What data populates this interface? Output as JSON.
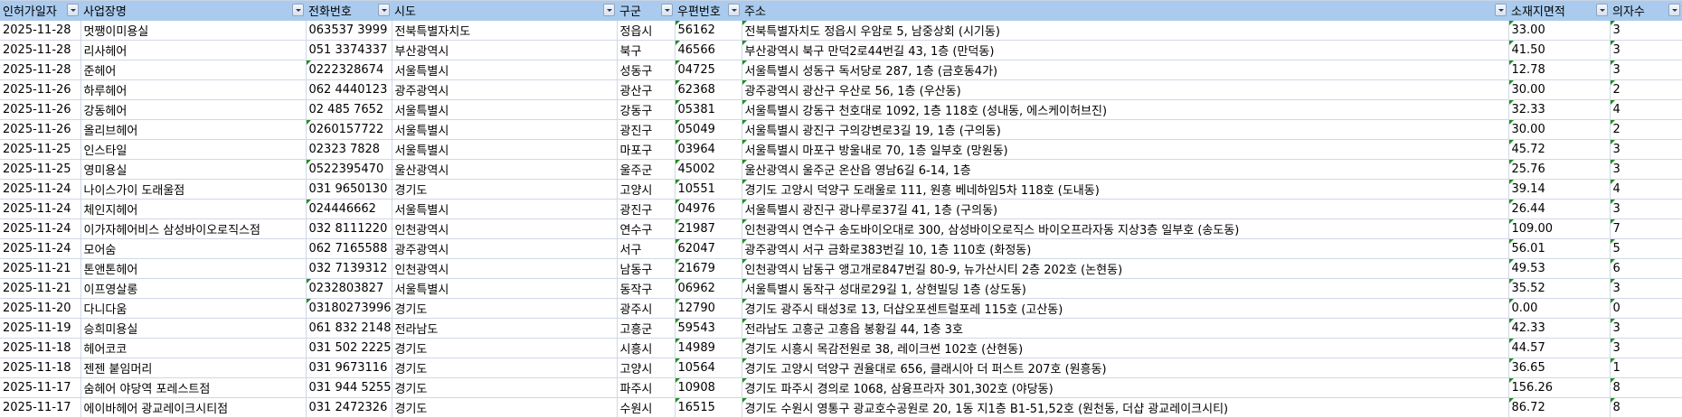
{
  "columns": [
    "인허가일자",
    "사업장명",
    "전화번호",
    "시도",
    "구군",
    "우편번호",
    "주소",
    "소재지면적",
    "의자수"
  ],
  "rows": [
    [
      "2025-11-28",
      "멋쨍이미용실",
      "063537 3999",
      "전북특별자치도",
      "정읍시",
      "56162",
      "전북특별자치도 정읍시 우암로 5, 남중상회 (시기동)",
      "33.00",
      "3"
    ],
    [
      "2025-11-28",
      "리사헤어",
      "051 3374337",
      "부산광역시",
      "북구",
      "46566",
      "부산광역시 북구 만덕2로44번길 43, 1층 (만덕동)",
      "41.50",
      "3"
    ],
    [
      "2025-11-28",
      "준헤어",
      "0222328674",
      "서울특별시",
      "성동구",
      "04725",
      "서울특별시 성동구 독서당로 287, 1층 (금호동4가)",
      "12.78",
      "3"
    ],
    [
      "2025-11-26",
      "하루헤어",
      "062 4440123",
      "광주광역시",
      "광산구",
      "62368",
      "광주광역시 광산구 우산로 56, 1층 (우산동)",
      "30.00",
      "2"
    ],
    [
      "2025-11-26",
      "강동헤어",
      "02  485 7652",
      "서울특별시",
      "강동구",
      "05381",
      "서울특별시 강동구 천호대로 1092, 1층 118호 (성내동, 에스케이허브진)",
      "32.33",
      "4"
    ],
    [
      "2025-11-26",
      "올리브헤어",
      "0260157722",
      "서울특별시",
      "광진구",
      "05049",
      "서울특별시 광진구 구의강변로3길 19, 1층 (구의동)",
      "30.00",
      "2"
    ],
    [
      "2025-11-25",
      "인스타일",
      "02323 7828",
      "서울특별시",
      "마포구",
      "03964",
      "서울특별시 마포구 방울내로 70, 1층 일부호 (망원동)",
      "45.72",
      "3"
    ],
    [
      "2025-11-25",
      "영미용실",
      "0522395470",
      "울산광역시",
      "울주군",
      "45002",
      "울산광역시 울주군 온산읍 영남6길 6-14, 1층",
      "25.76",
      "3"
    ],
    [
      "2025-11-24",
      "나이스가이 도래울점",
      "031 9650130",
      "경기도",
      "고양시",
      "10551",
      "경기도 고양시 덕양구 도래울로 111, 원흥 베네하임5차 118호 (도내동)",
      "39.14",
      "4"
    ],
    [
      "2025-11-24",
      "체인지헤어",
      "024446662",
      "서울특별시",
      "광진구",
      "04976",
      "서울특별시 광진구 광나루로37길 41, 1층 (구의동)",
      "26.44",
      "3"
    ],
    [
      "2025-11-24",
      "이가자헤어비스 삼성바이오로직스점",
      "032 8111220",
      "인천광역시",
      "연수구",
      "21987",
      "인천광역시 연수구 송도바이오대로 300, 삼성바이오로직스 바이오프라자동 지상3층 일부호 (송도동)",
      "109.00",
      "7"
    ],
    [
      "2025-11-24",
      "모어숨",
      "062 7165588",
      "광주광역시",
      "서구",
      "62047",
      "광주광역시 서구 금화로383번길 10, 1층 110호 (화정동)",
      "56.01",
      "5"
    ],
    [
      "2025-11-21",
      "톤앤톤헤어",
      "032 7139312",
      "인천광역시",
      "남동구",
      "21679",
      "인천광역시 남동구 앵고개로847번길 80-9, 뉴가산시티 2층 202호 (논현동)",
      "49.53",
      "6"
    ],
    [
      "2025-11-21",
      "이프영살롱",
      "0232803827",
      "서울특별시",
      "동작구",
      "06962",
      "서울특별시 동작구 성대로29길 1, 상현빌딩 1층 (상도동)",
      "35.52",
      "3"
    ],
    [
      "2025-11-20",
      "다니다움",
      "03180273996",
      "경기도",
      "광주시",
      "12790",
      "경기도 광주시 태성3로 13, 더샵오포센트럴포레 115호 (고산동)",
      "0.00",
      "0"
    ],
    [
      "2025-11-19",
      "승희미용실",
      "061 832 2148",
      "전라남도",
      "고흥군",
      "59543",
      "전라남도 고흥군 고흥읍 봉황길 44, 1층 3호",
      "42.33",
      "3"
    ],
    [
      "2025-11-18",
      "헤어코코",
      "031 502 2225",
      "경기도",
      "시흥시",
      "14989",
      "경기도 시흥시 목감전원로 38, 레이크썬 102호 (산현동)",
      "44.57",
      "3"
    ],
    [
      "2025-11-18",
      "젠젠 붙임머리",
      "031 9673116",
      "경기도",
      "고양시",
      "10564",
      "경기도 고양시 덕양구 권율대로 656, 클래시아 더 퍼스트 207호 (원흥동)",
      "36.65",
      "1"
    ],
    [
      "2025-11-17",
      "숨헤어 야당역 포레스트점",
      "031 944 5255",
      "경기도",
      "파주시",
      "10908",
      "경기도 파주시 경의로 1068, 삼융프라자 301,302호 (야당동)",
      "156.26",
      "8"
    ],
    [
      "2025-11-17",
      "에이바헤어 광교레이크시티점",
      "031 2472326",
      "경기도",
      "수원시",
      "16515",
      "경기도 수원시 영통구 광교호수공원로 20, 1동 지1층 B1-51,52호 (원천동, 더샵 광교레이크시티)",
      "86.72",
      "8"
    ]
  ],
  "colors": {
    "header_bg": "#AACBEE",
    "grid": "#D0D7E5",
    "error_flag": "#1E8F1E"
  }
}
